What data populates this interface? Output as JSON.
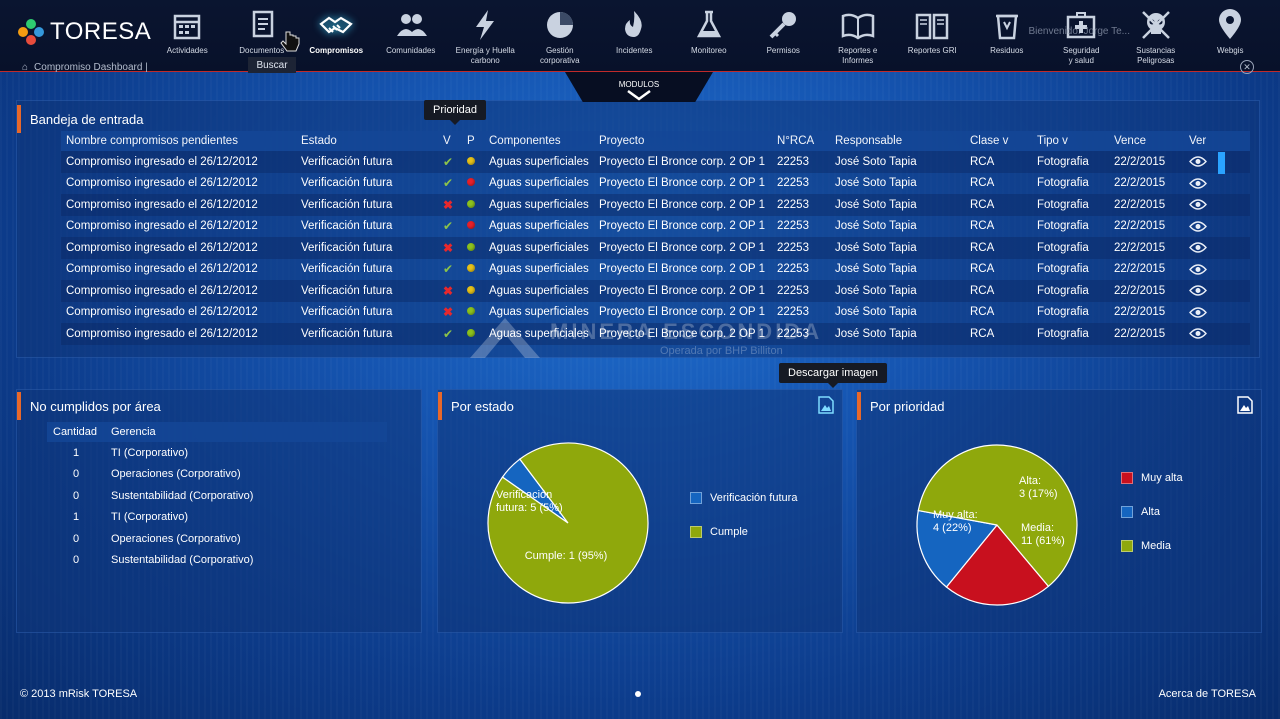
{
  "app": {
    "logo_text": "TORESA",
    "welcome_text": "Bienvenido: Jorge Te...",
    "breadcrumb": "Compromiso Dashboard |",
    "search_tooltip": "Buscar",
    "modulos_label": "MODULOS"
  },
  "nav": [
    {
      "label": "Actividades",
      "icon": "calendar-icon"
    },
    {
      "label": "Documentos",
      "icon": "document-icon"
    },
    {
      "label": "Compromisos",
      "icon": "handshake-icon",
      "active": true
    },
    {
      "label": "Comunidades",
      "icon": "people-icon"
    },
    {
      "label": "Energía y Huella\ncarbono",
      "icon": "lightning-icon"
    },
    {
      "label": "Gestión\ncorporativa",
      "icon": "pie-icon"
    },
    {
      "label": "Incidentes",
      "icon": "fire-icon"
    },
    {
      "label": "Monitoreo",
      "icon": "flask-icon"
    },
    {
      "label": "Permisos",
      "icon": "key-icon"
    },
    {
      "label": "Reportes e\nInformes",
      "icon": "open-book-icon"
    },
    {
      "label": "Reportes GRI",
      "icon": "book-icon"
    },
    {
      "label": "Residuos",
      "icon": "bin-icon"
    },
    {
      "label": "Seguridad\ny salud",
      "icon": "first-aid-icon"
    },
    {
      "label": "Sustancias\nPeligrosas",
      "icon": "skull-icon"
    },
    {
      "label": "Webgis",
      "icon": "map-pin-icon"
    }
  ],
  "inbox": {
    "title": "Bandeja de entrada",
    "tooltip": "Prioridad",
    "columns": [
      "Nombre compromisos pendientes",
      "Estado",
      "V",
      "P",
      "Componentes",
      "Proyecto",
      "N°RCA",
      "Responsable",
      "Clase v",
      "Tipo  v",
      "Vence",
      "Ver"
    ],
    "rows": [
      {
        "nombre": "Compromiso ingresado el 26/12/2012",
        "estado": "Verificación futura",
        "v": "ok",
        "p": "#e6c21a",
        "componentes": "Aguas superficiales",
        "proyecto": "Proyecto El Bronce corp. 2 OP 1",
        "rca": "22253",
        "responsable": "José Soto Tapia",
        "clase": "RCA",
        "tipo": "Fotografia",
        "vence": "22/2/2015"
      },
      {
        "nombre": "Compromiso ingresado el 26/12/2012",
        "estado": "Verificación futura",
        "v": "ok",
        "p": "#e8202a",
        "componentes": "Aguas superficiales",
        "proyecto": "Proyecto El Bronce corp. 2 OP 1",
        "rca": "22253",
        "responsable": "José Soto Tapia",
        "clase": "RCA",
        "tipo": "Fotografia",
        "vence": "22/2/2015"
      },
      {
        "nombre": "Compromiso ingresado el 26/12/2012",
        "estado": "Verificación futura",
        "v": "x",
        "p": "#8cc21e",
        "componentes": "Aguas superficiales",
        "proyecto": "Proyecto El Bronce corp. 2 OP 1",
        "rca": "22253",
        "responsable": "José Soto Tapia",
        "clase": "RCA",
        "tipo": "Fotografia",
        "vence": "22/2/2015"
      },
      {
        "nombre": "Compromiso ingresado el 26/12/2012",
        "estado": "Verificación futura",
        "v": "ok",
        "p": "#e8202a",
        "componentes": "Aguas superficiales",
        "proyecto": "Proyecto El Bronce corp. 2 OP 1",
        "rca": "22253",
        "responsable": "José Soto Tapia",
        "clase": "RCA",
        "tipo": "Fotografia",
        "vence": "22/2/2015"
      },
      {
        "nombre": "Compromiso ingresado el 26/12/2012",
        "estado": "Verificación futura",
        "v": "x",
        "p": "#8cc21e",
        "componentes": "Aguas superficiales",
        "proyecto": "Proyecto El Bronce corp. 2 OP 1",
        "rca": "22253",
        "responsable": "José Soto Tapia",
        "clase": "RCA",
        "tipo": "Fotografia",
        "vence": "22/2/2015"
      },
      {
        "nombre": "Compromiso ingresado el 26/12/2012",
        "estado": "Verificación futura",
        "v": "ok",
        "p": "#e6c21a",
        "componentes": "Aguas superficiales",
        "proyecto": "Proyecto El Bronce corp. 2 OP 1",
        "rca": "22253",
        "responsable": "José Soto Tapia",
        "clase": "RCA",
        "tipo": "Fotografia",
        "vence": "22/2/2015"
      },
      {
        "nombre": "Compromiso ingresado el 26/12/2012",
        "estado": "Verificación futura",
        "v": "x",
        "p": "#e6c21a",
        "componentes": "Aguas superficiales",
        "proyecto": "Proyecto El Bronce corp. 2 OP 1",
        "rca": "22253",
        "responsable": "José Soto Tapia",
        "clase": "RCA",
        "tipo": "Fotografia",
        "vence": "22/2/2015"
      },
      {
        "nombre": "Compromiso ingresado el 26/12/2012",
        "estado": "Verificación futura",
        "v": "x",
        "p": "#8cc21e",
        "componentes": "Aguas superficiales",
        "proyecto": "Proyecto El Bronce corp. 2 OP 1",
        "rca": "22253",
        "responsable": "José Soto Tapia",
        "clase": "RCA",
        "tipo": "Fotografia",
        "vence": "22/2/2015"
      },
      {
        "nombre": "Compromiso ingresado el 26/12/2012",
        "estado": "Verificación futura",
        "v": "ok",
        "p": "#8cc21e",
        "componentes": "Aguas superficiales",
        "proyecto": "Proyecto El Bronce corp. 2 OP 1",
        "rca": "22253",
        "responsable": "José Soto Tapia",
        "clase": "RCA",
        "tipo": "Fotografia",
        "vence": "22/2/2015"
      }
    ]
  },
  "watermark": {
    "name": "MINERA ESCONDIDA",
    "sub": "Operada por BHP Billiton"
  },
  "area_panel": {
    "title": "No cumplidos por área",
    "columns": [
      "Cantidad",
      "Gerencia"
    ],
    "rows": [
      {
        "cantidad": "1",
        "gerencia": "TI (Corporativo)"
      },
      {
        "cantidad": "0",
        "gerencia": "Operaciones (Corporativo)"
      },
      {
        "cantidad": "0",
        "gerencia": "Sustentabilidad (Corporativo)"
      },
      {
        "cantidad": "1",
        "gerencia": "TI (Corporativo)"
      },
      {
        "cantidad": "0",
        "gerencia": "Operaciones (Corporativo)"
      },
      {
        "cantidad": "0",
        "gerencia": "Sustentabilidad (Corporativo)"
      }
    ]
  },
  "estado_panel": {
    "title": "Por estado",
    "download_tooltip": "Descargar imagen",
    "legend": [
      {
        "label": "Verificación futura",
        "color": "#1565c0"
      },
      {
        "label": "Cumple",
        "color": "#8fa80c"
      }
    ]
  },
  "prioridad_panel": {
    "title": "Por prioridad",
    "legend": [
      {
        "label": "Muy alta",
        "color": "#c8101e"
      },
      {
        "label": "Alta",
        "color": "#1565c0"
      },
      {
        "label": "Media",
        "color": "#8fa80c"
      }
    ]
  },
  "chart_data": [
    {
      "type": "pie",
      "title": "Por estado",
      "categories": [
        "Verificación futura",
        "Cumple"
      ],
      "values": [
        5,
        95
      ],
      "slice_labels": [
        "Verificación futura: 5 (5%)",
        "Cumple: 1 (95%)"
      ],
      "colors": [
        "#1565c0",
        "#8fa80c"
      ]
    },
    {
      "type": "pie",
      "title": "Por prioridad",
      "categories": [
        "Muy alta",
        "Alta",
        "Media"
      ],
      "values": [
        22,
        17,
        61
      ],
      "slice_labels": [
        "Muy alta: 4 (22%)",
        "Alta: 3 (17%)",
        "Media: 11 (61%)"
      ],
      "colors": [
        "#c8101e",
        "#1565c0",
        "#8fa80c"
      ]
    }
  ],
  "footer": {
    "copyright": "© 2013 mRisk TORESA",
    "about": "Acerca de TORESA"
  }
}
